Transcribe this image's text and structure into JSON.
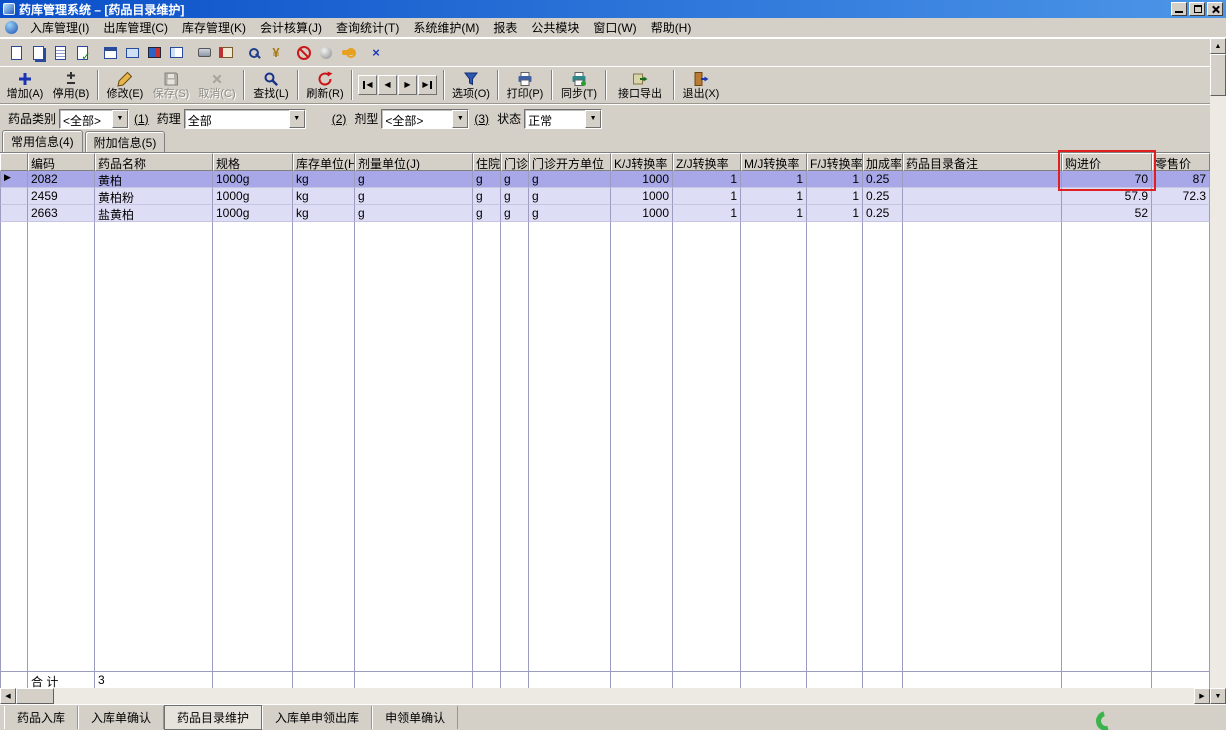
{
  "window": {
    "title": "药库管理系统 – [药品目录维护]"
  },
  "menu": {
    "items": [
      "入库管理(I)",
      "出库管理(C)",
      "库存管理(K)",
      "会计核算(J)",
      "查询统计(T)",
      "系统维护(M)",
      "报表",
      "公共模块",
      "窗口(W)",
      "帮助(H)"
    ]
  },
  "toolbar_small": {
    "icons": [
      "new-doc-icon",
      "copy-doc-icon",
      "doc-lines-icon",
      "doc-check-icon",
      "calendar-icon",
      "card-icon",
      "books-icon",
      "report-icon",
      "disk-icon",
      "book-icon",
      "search-icon",
      "money-icon",
      "forbidden-icon",
      "sphere-icon",
      "key-icon",
      "close-window-icon"
    ]
  },
  "toolbar": {
    "buttons": [
      {
        "label": "增加(A)",
        "icon": "add-icon",
        "enabled": true
      },
      {
        "label": "停用(B)",
        "icon": "disable-icon",
        "enabled": true
      },
      {
        "label": "修改(E)",
        "icon": "edit-icon",
        "enabled": true
      },
      {
        "label": "保存(S)",
        "icon": "save-icon",
        "enabled": false
      },
      {
        "label": "取消(C)",
        "icon": "cancel-icon",
        "enabled": false
      },
      {
        "label": "查找(L)",
        "icon": "find-icon",
        "enabled": true
      },
      {
        "label": "刷新(R)",
        "icon": "refresh-icon",
        "enabled": true
      },
      {
        "label": "选项(O)",
        "icon": "options-icon",
        "enabled": true
      },
      {
        "label": "打印(P)",
        "icon": "print-icon",
        "enabled": true
      },
      {
        "label": "同步(T)",
        "icon": "sync-icon",
        "enabled": true
      },
      {
        "label": "接口导出",
        "icon": "export-icon",
        "enabled": true
      },
      {
        "label": "退出(X)",
        "icon": "exit-icon",
        "enabled": true
      }
    ],
    "nav": [
      "first-record",
      "prev-record",
      "next-record",
      "last-record"
    ]
  },
  "filters": {
    "category": {
      "label": "药品类别",
      "value": "<全部>"
    },
    "num1": "(1)",
    "pharmacology": {
      "label": "药理",
      "value": "全部"
    },
    "num2": "(2)",
    "dosage_form": {
      "label": "剂型",
      "value": "<全部>"
    },
    "num3": "(3)",
    "status": {
      "label": "状态",
      "value": "正常"
    }
  },
  "tabs": {
    "items": [
      "常用信息(4)",
      "附加信息(5)"
    ],
    "active": 0
  },
  "table": {
    "columns": [
      "编码",
      "药品名称",
      "规格",
      "库存单位(H)",
      "剂量单位(J)",
      "住院",
      "门诊",
      "门诊开方单位",
      "K/J转换率",
      "Z/J转换率",
      "M/J转换率",
      "F/J转换率",
      "加成率",
      "药品目录备注",
      "购进价",
      "零售价"
    ],
    "rows": [
      [
        "2082",
        "黄柏",
        "1000g",
        "kg",
        "g",
        "g",
        "g",
        "g",
        "1000",
        "1",
        "1",
        "1",
        "0.25",
        "",
        "70",
        "87"
      ],
      [
        "2459",
        "黄柏粉",
        "1000g",
        "kg",
        "g",
        "g",
        "g",
        "g",
        "1000",
        "1",
        "1",
        "1",
        "0.25",
        "",
        "57.9",
        "72.3"
      ],
      [
        "2663",
        "盐黄柏",
        "1000g",
        "kg",
        "g",
        "g",
        "g",
        "g",
        "1000",
        "1",
        "1",
        "1",
        "0.25",
        "",
        "52",
        ""
      ]
    ],
    "selected_row": 0,
    "footer": {
      "label": "合 计",
      "count": "3"
    }
  },
  "bottom_tabs": {
    "items": [
      "药品入库",
      "入库单确认",
      "药品目录维护",
      "入库单申领出库",
      "申领单确认"
    ],
    "active": 2
  },
  "icons": {
    "dropdown": "▼",
    "up": "▲",
    "down": "▼",
    "left": "◀",
    "right": "▶",
    "row_pointer": "▶",
    "check": "✓",
    "yen": "¥",
    "close_glyph": "×"
  },
  "colors": {
    "titlebar_start": "#0a4fc8",
    "titlebar_end": "#4c96e8",
    "selected_row": "#a8a8e8",
    "row_bg": "#deddf6",
    "grid_line": "#9c9cc0",
    "highlight_box": "#e02020"
  }
}
